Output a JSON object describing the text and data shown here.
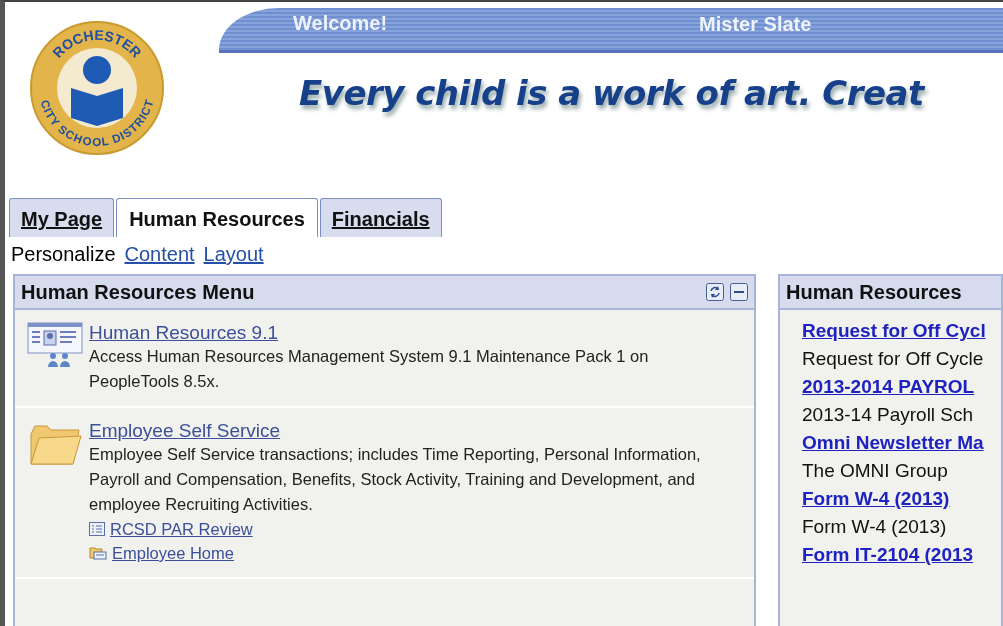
{
  "header": {
    "logo": {
      "top_text": "ROCHESTER",
      "bottom_text": "CITY SCHOOL DISTRICT"
    },
    "welcome": "Welcome!",
    "user": "Mister Slate",
    "tagline": "Every child is a work of art. Creat"
  },
  "tabs": [
    {
      "label": "My Page",
      "selected": false
    },
    {
      "label": "Human Resources",
      "selected": true
    },
    {
      "label": "Financials",
      "selected": false
    }
  ],
  "personalize": {
    "label": "Personalize",
    "links": [
      "Content",
      "Layout"
    ]
  },
  "left_panel": {
    "title": "Human Resources Menu",
    "items": [
      {
        "kind": "hr",
        "title": "Human Resources 9.1",
        "description": "Access Human Resources Management System 9.1 Maintenance Pack 1 on PeopleTools 8.5x."
      },
      {
        "kind": "folder",
        "title": "Employee Self Service",
        "description": "Employee Self Service transactions; includes Time Reporting, Personal Information, Payroll and Compensation, Benefits, Stock Activity, Training and Development, and employee Recruiting Activities.",
        "links": [
          {
            "kind": "page",
            "label": "RCSD PAR Review"
          },
          {
            "kind": "folder",
            "label": "Employee Home"
          }
        ]
      }
    ]
  },
  "right_panel": {
    "title": "Human Resources",
    "rows": [
      {
        "kind": "link",
        "text": "Request for Off Cycl"
      },
      {
        "kind": "text",
        "text": "Request for Off Cycle"
      },
      {
        "kind": "link",
        "text": "2013-2014 PAYROL"
      },
      {
        "kind": "text",
        "text": "2013-14 Payroll Sch"
      },
      {
        "kind": "link",
        "text": "Omni Newsletter Ma"
      },
      {
        "kind": "text",
        "text": "The OMNI Group"
      },
      {
        "kind": "link",
        "text": "Form W-4 (2013)"
      },
      {
        "kind": "text",
        "text": "Form W-4 (2013)"
      },
      {
        "kind": "link",
        "text": "Form IT-2104 (2013"
      }
    ]
  }
}
